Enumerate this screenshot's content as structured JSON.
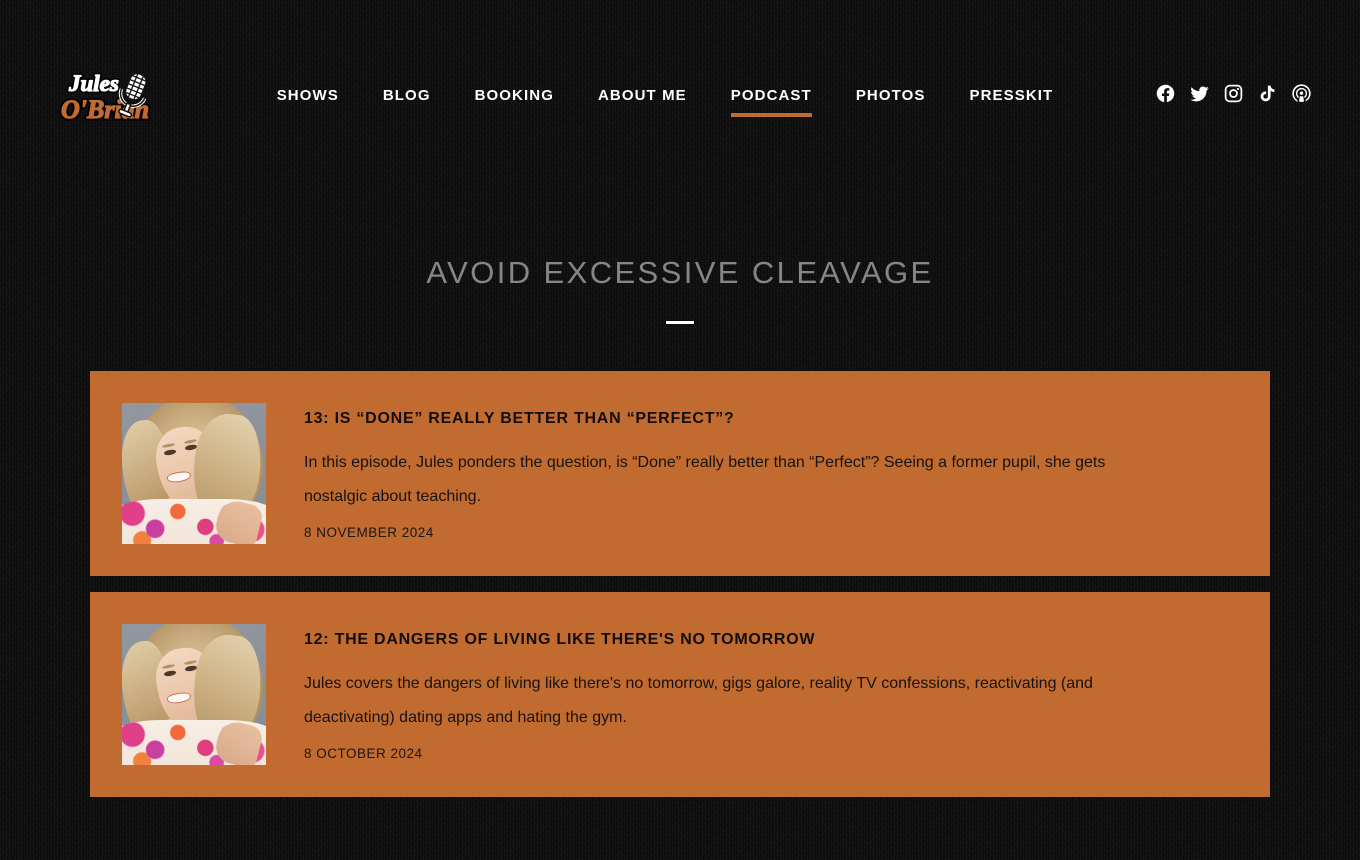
{
  "site": {
    "brand_name": "Jules O'Brian",
    "brand_line1": "Jules",
    "brand_line2": "O'Brian",
    "logo_icon": "microphone-icon",
    "accent_color": "#c26b30",
    "background_color": "#0a0a0a",
    "title_color": "#84878a"
  },
  "nav": {
    "items": [
      {
        "label": "SHOWS",
        "active": false
      },
      {
        "label": "BLOG",
        "active": false
      },
      {
        "label": "BOOKING",
        "active": false
      },
      {
        "label": "ABOUT ME",
        "active": false
      },
      {
        "label": "PODCAST",
        "active": true
      },
      {
        "label": "PHOTOS",
        "active": false
      },
      {
        "label": "PRESSKIT",
        "active": false
      }
    ]
  },
  "social": {
    "items": [
      {
        "name": "facebook-icon",
        "label": "Facebook"
      },
      {
        "name": "twitter-icon",
        "label": "Twitter"
      },
      {
        "name": "instagram-icon",
        "label": "Instagram"
      },
      {
        "name": "tiktok-icon",
        "label": "TikTok"
      },
      {
        "name": "podcast-icon",
        "label": "Podcast"
      }
    ]
  },
  "hero": {
    "title": "AVOID EXCESSIVE CLEAVAGE"
  },
  "episodes": [
    {
      "title": "13: IS “DONE” REALLY BETTER THAN “PERFECT”?",
      "description": "In this episode, Jules ponders the question, is “Done” really better than “Perfect”? Seeing a former pupil, she gets nostalgic about teaching.",
      "date": "8 NOVEMBER 2024",
      "thumbnail_alt": "Jules O'Brian portrait"
    },
    {
      "title": "12: THE DANGERS OF LIVING LIKE THERE'S NO TOMORROW",
      "description": "Jules covers the dangers of living like there's no tomorrow, gigs galore, reality TV confessions, reactivating (and deactivating) dating apps and hating the gym.",
      "date": "8 OCTOBER 2024",
      "thumbnail_alt": "Jules O'Brian portrait"
    }
  ]
}
